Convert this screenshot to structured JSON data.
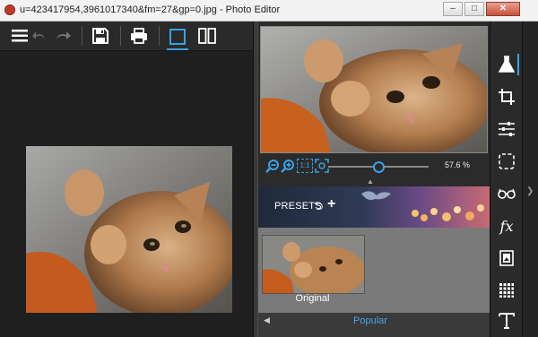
{
  "window": {
    "title": "u=423417954,3961017340&fm=27&gp=0.jpg - Photo Editor",
    "minimize": "–",
    "maximize": "□",
    "close": "✕"
  },
  "toolbar": {
    "icons": [
      "menu-icon",
      "undo-icon",
      "redo-icon",
      "save-icon",
      "print-icon",
      "single-view-icon",
      "split-view-icon"
    ]
  },
  "navigator": {
    "zoom_value": "57.6 %",
    "zoom_level": 0.5,
    "fit_label": "1:1"
  },
  "presets": {
    "label": "PRESETS",
    "undo_glyph": "⮌",
    "add_glyph": "+",
    "items": [
      {
        "name": "Original"
      }
    ],
    "tab_label": "Popular",
    "tab_arrow": "◀"
  },
  "side_tools": [
    "flask-icon",
    "crop-icon",
    "adjust-sliders-icon",
    "selection-icon",
    "glasses-icon",
    "fx-icon",
    "frame-icon",
    "texture-icon",
    "text-icon"
  ],
  "side_collapse": "❯",
  "colors": {
    "accent": "#3ba0e6"
  }
}
